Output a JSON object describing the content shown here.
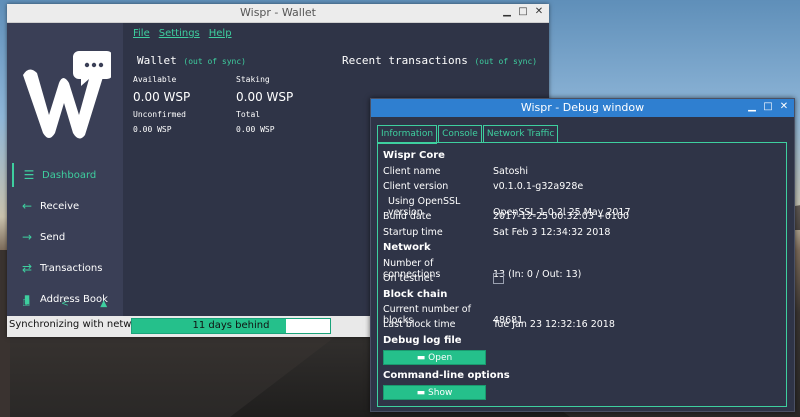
{
  "wallet_window": {
    "title": "Wispr - Wallet",
    "menu": [
      "File",
      "Settings",
      "Help"
    ],
    "nav": [
      {
        "label": "Dashboard",
        "icon": "list-icon",
        "glyph": "☰"
      },
      {
        "label": "Receive",
        "icon": "arrow-left-icon",
        "glyph": "←"
      },
      {
        "label": "Send",
        "icon": "arrow-right-icon",
        "glyph": "→"
      },
      {
        "label": "Transactions",
        "icon": "exchange-icon",
        "glyph": "⇄"
      },
      {
        "label": "Address Book",
        "icon": "book-icon",
        "glyph": "▮"
      }
    ],
    "bottom_icons": [
      {
        "name": "lock-icon",
        "glyph": "🔒"
      },
      {
        "name": "share-icon",
        "glyph": "<"
      },
      {
        "name": "thumb-icon",
        "glyph": "👍"
      }
    ],
    "wallet_heading": "Wallet",
    "out_of_sync": "(out of sync)",
    "available_label": "Available",
    "available_value": "0.00 WSP",
    "staking_label": "Staking",
    "staking_value": "0.00 WSP",
    "unconfirmed_label": "Unconfirmed",
    "unconfirmed_value": "0.00 WSP",
    "total_label": "Total",
    "total_value": "0.00 WSP",
    "recent_heading": "Recent transactions",
    "status_text": "Synchronizing with network...",
    "progress_text": "11 days behind",
    "progress_fraction": 0.78
  },
  "debug_window": {
    "title": "Wispr - Debug window",
    "tabs": [
      "Information",
      "Console",
      "Network Traffic"
    ],
    "core_heading": "Wispr Core",
    "client_name_label": "Client name",
    "client_name_value": "Satoshi",
    "client_version_label": "Client version",
    "client_version_value": "v0.1.0.1-g32a928e",
    "openssl_label": "Using OpenSSL version",
    "openssl_value": "OpenSSL 1.0.2l  25 May 2017",
    "build_date_label": "Build date",
    "build_date_value": "2017-12-25 00:32:03 +0100",
    "startup_label": "Startup time",
    "startup_value": "Sat Feb 3 12:34:32 2018",
    "network_heading": "Network",
    "connections_label": "Number of connections",
    "connections_value": "13 (In: 0 / Out: 13)",
    "testnet_label": "On testnet",
    "blockchain_heading": "Block chain",
    "blocks_label": "Current number of blocks",
    "blocks_value": "48681",
    "last_block_label": "Last block time",
    "last_block_value": "Tue Jan 23 12:32:16 2018",
    "debug_log_heading": "Debug log file",
    "open_button": "Open",
    "cmd_heading": "Command-line options",
    "show_button": "Show"
  }
}
